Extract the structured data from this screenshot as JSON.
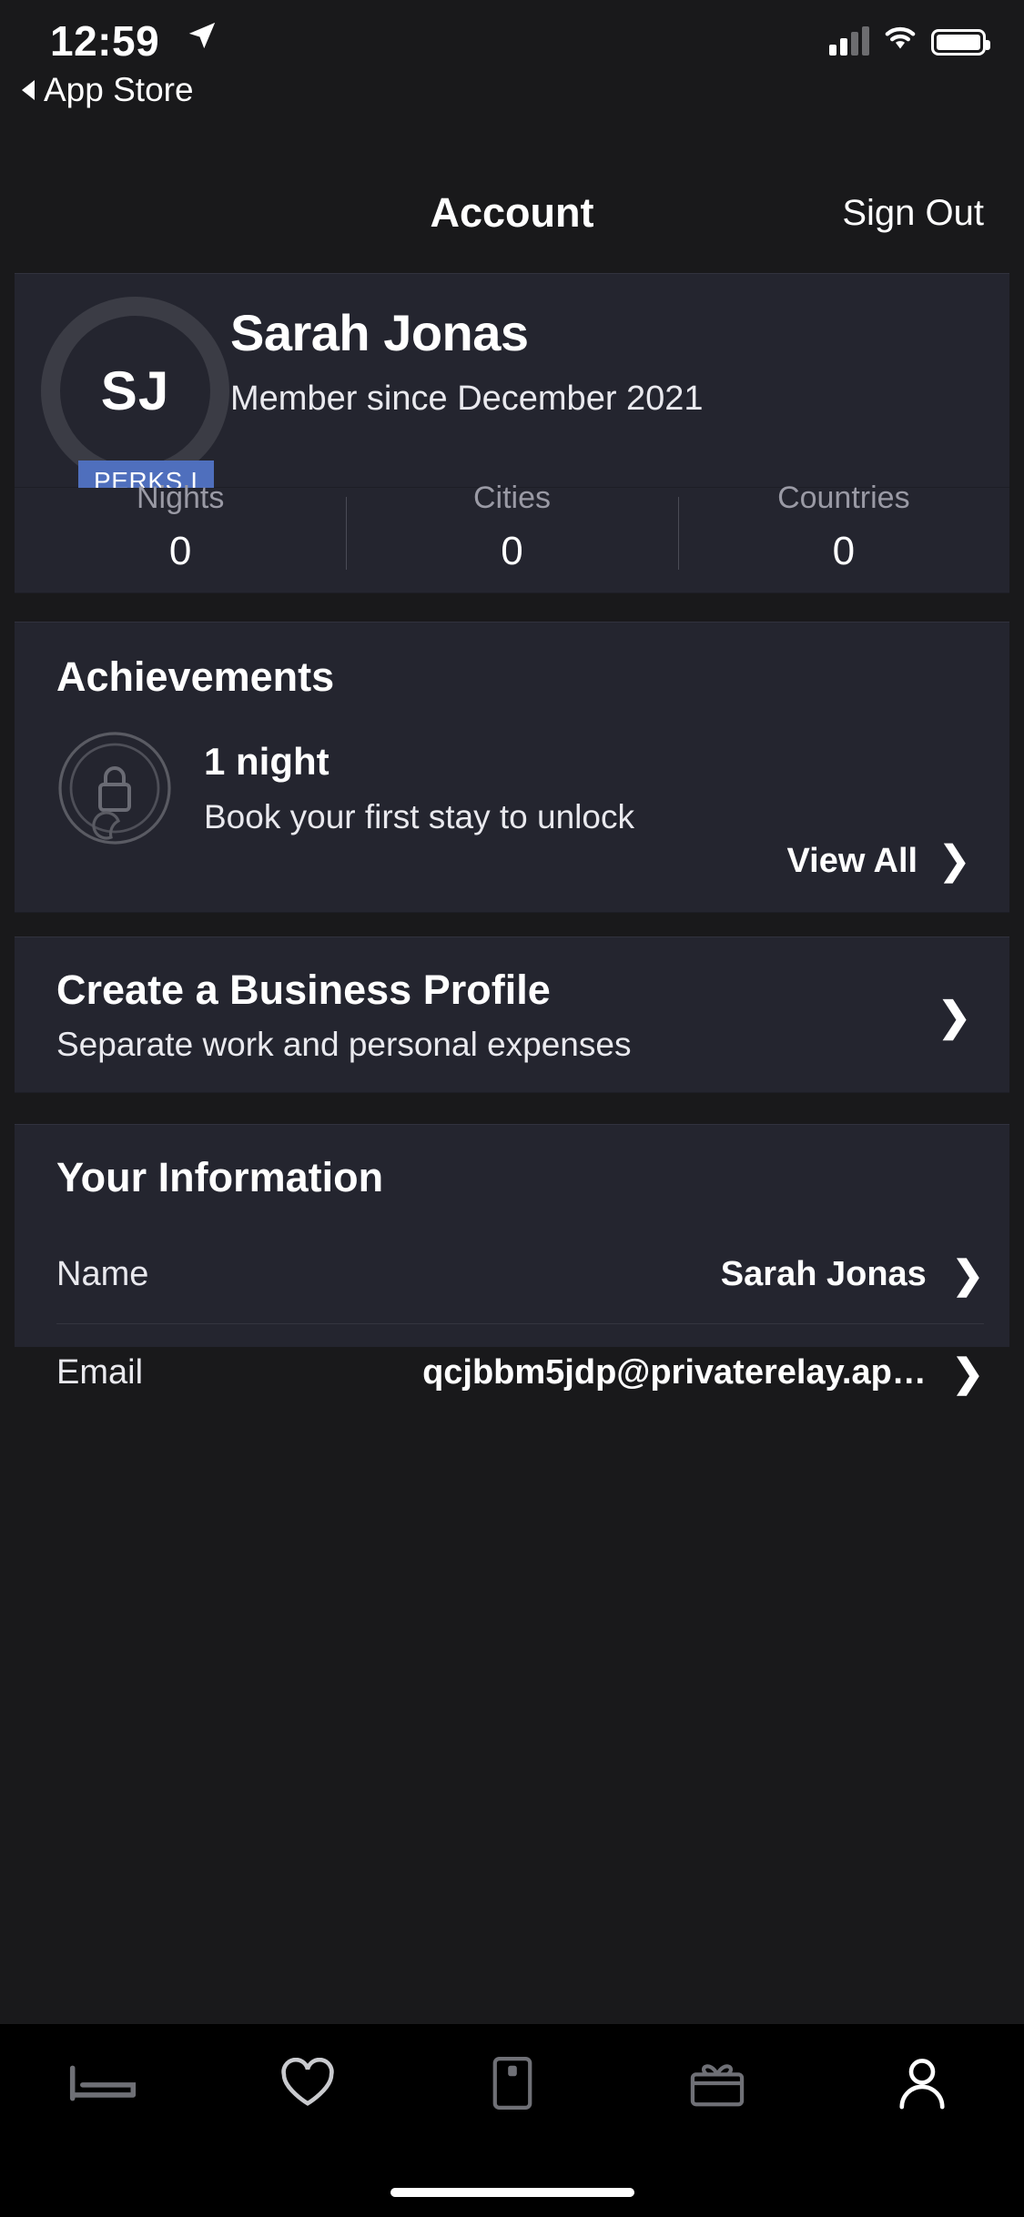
{
  "status_bar": {
    "time": "12:59",
    "location_icon": "location-arrow-icon",
    "back_label": "App Store",
    "signal_icon": "cellular-signal-icon",
    "wifi_icon": "wifi-icon",
    "battery_icon": "battery-full-icon"
  },
  "nav": {
    "title": "Account",
    "sign_out": "Sign Out"
  },
  "profile": {
    "initials": "SJ",
    "name": "Sarah Jonas",
    "member_since": "Member since December 2021",
    "perks_badge": "PERKS I",
    "perks_badge_color": "#4f6fbd",
    "stats": [
      {
        "label": "Nights",
        "value": "0"
      },
      {
        "label": "Cities",
        "value": "0"
      },
      {
        "label": "Countries",
        "value": "0"
      }
    ]
  },
  "achievements": {
    "title": "Achievements",
    "badge_icon": "locked-moon-badge-icon",
    "item_title": "1 night",
    "item_subtitle": "Book your first stay to unlock",
    "view_all": "View All",
    "chevron_icon": "chevron-right-icon"
  },
  "business": {
    "title": "Create a Business Profile",
    "subtitle": "Separate work and personal expenses",
    "chevron_icon": "chevron-right-icon"
  },
  "information": {
    "title": "Your Information",
    "rows": [
      {
        "label": "Name",
        "value": "Sarah Jonas",
        "chevron_icon": "chevron-right-icon"
      },
      {
        "label": "Email",
        "value": "qcjbbm5jdp@privaterelay.ap…",
        "chevron_icon": "chevron-right-icon"
      }
    ]
  },
  "tabbar": {
    "items": [
      {
        "icon": "bed-icon",
        "active": false
      },
      {
        "icon": "heart-icon",
        "active": false
      },
      {
        "icon": "door-icon",
        "active": false
      },
      {
        "icon": "gift-icon",
        "active": false
      },
      {
        "icon": "person-icon",
        "active": true
      }
    ]
  },
  "theme": {
    "background": "#19191b",
    "card": "#24252f",
    "accent": "#4f6fbd"
  }
}
